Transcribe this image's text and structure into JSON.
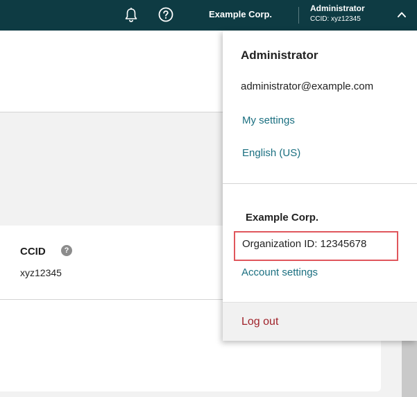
{
  "header": {
    "bell_icon": "bell-icon",
    "help_icon": "question-circle-icon",
    "org_name": "Example Corp.",
    "user_name": "Administrator",
    "user_ccid": "CCID: xyz12345",
    "chevron_icon": "chevron-up-icon",
    "background_color": "#0e3b43"
  },
  "ccid_card": {
    "label": "CCID",
    "info_icon_glyph": "?",
    "value": "xyz12345"
  },
  "dropdown": {
    "user_name": "Administrator",
    "email": "administrator@example.com",
    "my_settings": "My settings",
    "language": "English (US)",
    "org_name": "Example Corp.",
    "org_id": "Organization ID: 12345678",
    "account_settings": "Account settings",
    "logout": "Log out",
    "link_color": "#1a6f80",
    "logout_color": "#a0222a",
    "highlight_color": "#e0565c"
  }
}
